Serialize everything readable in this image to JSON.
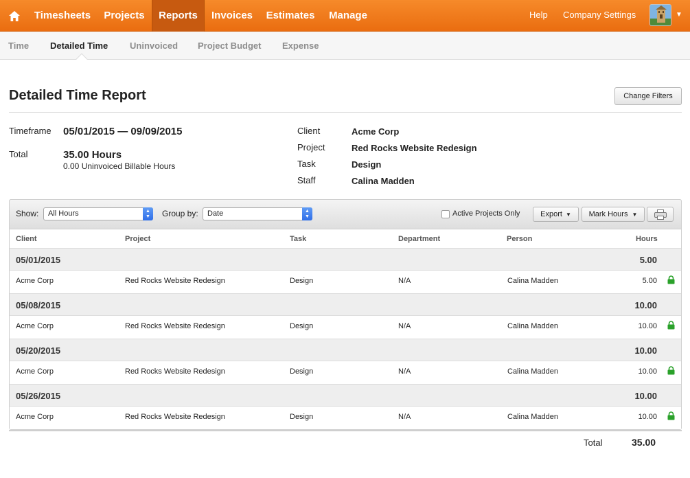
{
  "topnav": {
    "items": [
      "Timesheets",
      "Projects",
      "Reports",
      "Invoices",
      "Estimates",
      "Manage"
    ],
    "active": "Reports",
    "help": "Help",
    "company_settings": "Company Settings",
    "brand_color": "#f37b1d"
  },
  "subnav": {
    "items": [
      "Time",
      "Detailed Time",
      "Uninvoiced",
      "Project Budget",
      "Expense"
    ],
    "active": "Detailed Time"
  },
  "report": {
    "title": "Detailed Time Report",
    "change_filters": "Change Filters",
    "timeframe_label": "Timeframe",
    "timeframe_value": "05/01/2015 — 09/09/2015",
    "total_label": "Total",
    "total_hours": "35.00 Hours",
    "uninvoiced": "0.00 Uninvoiced Billable Hours",
    "client_label": "Client",
    "client_value": "Acme Corp",
    "project_label": "Project",
    "project_value": "Red Rocks Website Redesign",
    "task_label": "Task",
    "task_value": "Design",
    "staff_label": "Staff",
    "staff_value": "Calina Madden"
  },
  "toolbar": {
    "show_label": "Show:",
    "show_value": "All Hours",
    "group_label": "Group by:",
    "group_value": "Date",
    "active_only": "Active Projects Only",
    "export": "Export",
    "mark_hours": "Mark Hours"
  },
  "table": {
    "columns": [
      "Client",
      "Project",
      "Task",
      "Department",
      "Person",
      "Hours"
    ],
    "groups": [
      {
        "date": "05/01/2015",
        "total": "5.00",
        "row": {
          "client": "Acme Corp",
          "project": "Red Rocks Website Redesign",
          "task": "Design",
          "department": "N/A",
          "person": "Calina Madden",
          "hours": "5.00"
        }
      },
      {
        "date": "05/08/2015",
        "total": "10.00",
        "row": {
          "client": "Acme Corp",
          "project": "Red Rocks Website Redesign",
          "task": "Design",
          "department": "N/A",
          "person": "Calina Madden",
          "hours": "10.00"
        }
      },
      {
        "date": "05/20/2015",
        "total": "10.00",
        "row": {
          "client": "Acme Corp",
          "project": "Red Rocks Website Redesign",
          "task": "Design",
          "department": "N/A",
          "person": "Calina Madden",
          "hours": "10.00"
        }
      },
      {
        "date": "05/26/2015",
        "total": "10.00",
        "row": {
          "client": "Acme Corp",
          "project": "Red Rocks Website Redesign",
          "task": "Design",
          "department": "N/A",
          "person": "Calina Madden",
          "hours": "10.00"
        }
      }
    ],
    "total_label": "Total",
    "total_value": "35.00",
    "lock_icon": "lock-icon",
    "lock_color": "#2aa12a"
  }
}
